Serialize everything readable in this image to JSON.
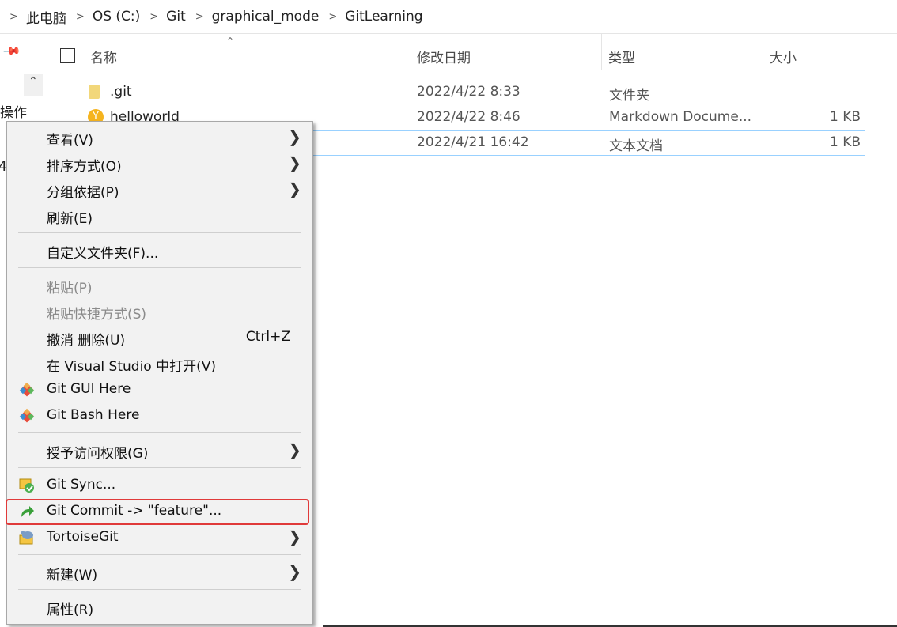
{
  "breadcrumb": {
    "items": [
      "此电脑",
      "OS (C:)",
      "Git",
      "graphical_mode",
      "GitLearning"
    ]
  },
  "leftpane": {
    "text1": "操作",
    "text2": "4"
  },
  "columns": {
    "name": "名称",
    "modified": "修改日期",
    "type": "类型",
    "size": "大小"
  },
  "files": [
    {
      "name": ".git",
      "modified": "2022/4/22 8:33",
      "type": "文件夹",
      "size": "",
      "icon": "folder-icon"
    },
    {
      "name": "helloworld",
      "modified": "2022/4/22 8:46",
      "type": "Markdown Docume...",
      "size": "1 KB",
      "icon": "markdown-file-icon"
    },
    {
      "name": "",
      "modified": "2022/4/21 16:42",
      "type": "文本文档",
      "size": "1 KB",
      "icon": ""
    }
  ],
  "context_menu": {
    "items": [
      {
        "label": "查看(V)",
        "submenu": true
      },
      {
        "label": "排序方式(O)",
        "submenu": true
      },
      {
        "label": "分组依据(P)",
        "submenu": true
      },
      {
        "label": "刷新(E)"
      },
      {
        "label": "自定义文件夹(F)..."
      },
      {
        "label": "粘贴(P)",
        "disabled": true
      },
      {
        "label": "粘贴快捷方式(S)",
        "disabled": true
      },
      {
        "label": "撤消 删除(U)",
        "shortcut": "Ctrl+Z"
      },
      {
        "label": "在 Visual Studio 中打开(V)"
      },
      {
        "label": "Git GUI Here",
        "icon": "git-logo-icon"
      },
      {
        "label": "Git Bash Here",
        "icon": "git-logo-icon"
      },
      {
        "label": "授予访问权限(G)",
        "submenu": true
      },
      {
        "label": "Git Sync...",
        "icon": "git-sync-icon"
      },
      {
        "label": "Git Commit -> \"feature\"...",
        "icon": "git-commit-icon",
        "highlighted": true
      },
      {
        "label": "TortoiseGit",
        "icon": "tortoisegit-icon",
        "submenu": true
      },
      {
        "label": "新建(W)",
        "submenu": true
      },
      {
        "label": "属性(R)"
      }
    ]
  },
  "colors": {
    "highlight_border": "#e03a3a",
    "selected_row_border": "#99d1ff",
    "menu_background": "#f2f2f2"
  }
}
